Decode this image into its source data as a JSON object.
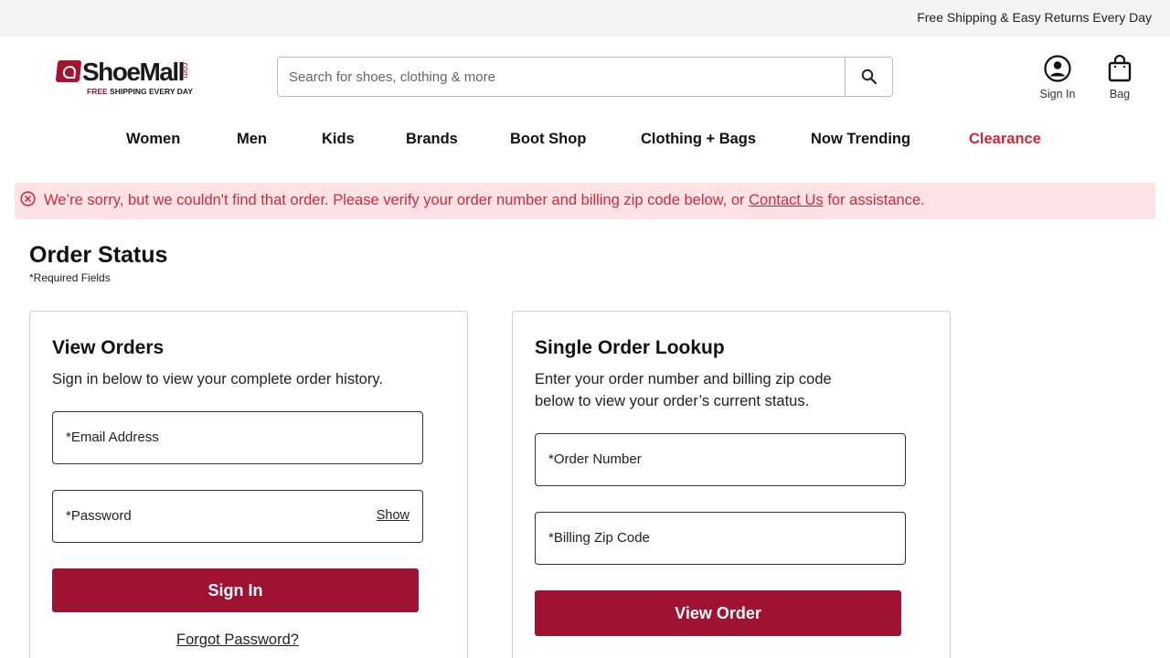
{
  "promo": {
    "text": "Free Shipping & Easy Returns Every Day"
  },
  "logo": {
    "name": "ShoeMall",
    "com": ".com",
    "tag_free": "FREE",
    "tag_rest": " SHIPPING EVERY DAY"
  },
  "search": {
    "placeholder": "Search for shoes, clothing & more",
    "value": ""
  },
  "account": {
    "signin_label": "Sign In",
    "bag_label": "Bag"
  },
  "nav": {
    "items": [
      {
        "label": "Women"
      },
      {
        "label": "Men"
      },
      {
        "label": "Kids"
      },
      {
        "label": "Brands"
      },
      {
        "label": "Boot Shop"
      },
      {
        "label": "Clothing + Bags"
      },
      {
        "label": "Now Trending"
      },
      {
        "label": "Clearance"
      }
    ]
  },
  "alert": {
    "text_before": "We’re sorry, but we couldn't find that order. Please verify your order number and billing zip code below, or ",
    "link": "Contact Us",
    "text_after": " for assistance."
  },
  "page": {
    "title": "Order Status",
    "required_note": "*Required Fields"
  },
  "view_orders": {
    "title": "View Orders",
    "description": "Sign in below to view your complete order history.",
    "email_label": "*Email Address",
    "password_label": "*Password",
    "show_label": "Show",
    "signin_button": "Sign In",
    "forgot_link": "Forgot Password?"
  },
  "single_lookup": {
    "title": "Single Order Lookup",
    "description_line1": "Enter your order number and billing zip code",
    "description_line2": "below to view your order’s current status.",
    "order_number_label": "*Order Number",
    "zip_label": "*Billing Zip Code",
    "view_button": "View Order"
  },
  "colors": {
    "brand": "#a01232",
    "alert_text": "#d02a3b",
    "alert_bg": "#fde3e5",
    "clearance": "#d6263a"
  }
}
